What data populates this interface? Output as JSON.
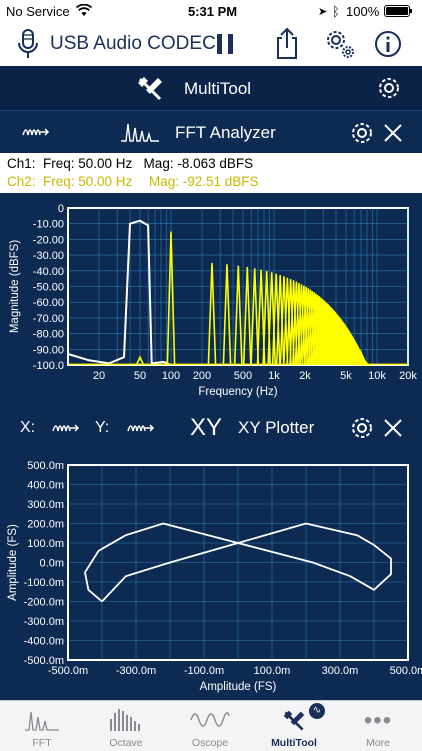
{
  "status": {
    "carrier": "No Service",
    "time": "5:31 PM",
    "battery": "100%"
  },
  "toolbar": {
    "device": "USB Audio CODEC"
  },
  "multitool": {
    "title": "MultiTool"
  },
  "fft": {
    "title": "FFT Analyzer",
    "ch1": "Ch1:  Freq: 50.00 Hz   Mag: -8.063 dBFS",
    "ch2_freq": "Ch2:  Freq: 50.00 Hz",
    "ch2_mag": "Mag: -92.51 dBFS",
    "colors": {
      "ch1": "#ffffff",
      "ch2": "#ffff00",
      "grid": "#3aa0d8"
    }
  },
  "xy": {
    "x_label": "X:",
    "y_label": "Y:",
    "big": "XY",
    "title": "XY Plotter"
  },
  "chart_data": [
    {
      "type": "line",
      "title": "",
      "xlabel": "Frequency (Hz)",
      "ylabel": "Magnitude (dBFS)",
      "xscale": "log",
      "xlim": [
        10,
        20000
      ],
      "ylim": [
        -100,
        0
      ],
      "x_ticks": [
        "20",
        "50",
        "100",
        "200",
        "500",
        "1k",
        "2k",
        "5k",
        "10k",
        "20k"
      ],
      "y_ticks": [
        "0",
        "-10.00",
        "-20.00",
        "-30.00",
        "-40.00",
        "-50.00",
        "-60.00",
        "-70.00",
        "-80.00",
        "-90.00",
        "-100.0"
      ],
      "series": [
        {
          "points": [
            [
              10,
              -93
            ],
            [
              16,
              -97
            ],
            [
              25,
              -99
            ],
            [
              35,
              -95
            ],
            [
              40,
              -10
            ],
            [
              50,
              -8.063
            ],
            [
              60,
              -11
            ],
            [
              65,
              -99
            ],
            [
              85,
              -98
            ],
            [
              100,
              -100
            ],
            [
              200,
              -100
            ],
            [
              1000,
              -100
            ],
            [
              20000,
              -100
            ]
          ]
        },
        {
          "harmonic_peaks_hz": [
            50,
            100,
            250,
            350,
            450,
            550,
            650,
            750,
            850,
            950,
            1050,
            1150,
            1250,
            1350,
            1450,
            1550,
            1650,
            1750,
            1850,
            1950,
            2050,
            2150,
            2250,
            2350,
            2450,
            2550,
            2650,
            2750,
            2850,
            2950,
            3050,
            3150,
            3250,
            3350,
            3450,
            3550,
            3650,
            3750,
            3850,
            3950,
            4050,
            4150,
            4250,
            4350,
            4450,
            4550,
            4650,
            4750,
            4850,
            4950,
            5050,
            5150,
            5250,
            5350,
            5450,
            5550,
            5650,
            5750,
            5850,
            5950,
            6050,
            6150,
            6250,
            6350,
            6450,
            6550,
            6650,
            6750,
            6850,
            6950,
            7050,
            7150,
            7250,
            7350,
            7450,
            7550,
            7650,
            7750,
            7850,
            7950,
            8050
          ],
          "fundamental_dbfs": -15,
          "base_level_dbfs": -100,
          "ch2_50hz_dbfs": -92.51
        }
      ],
      "grid": true
    },
    {
      "type": "line",
      "title": "",
      "xlabel": "Amplitude (FS)",
      "ylabel": "Amplitude (FS)",
      "xlim": [
        -0.5,
        0.5
      ],
      "ylim": [
        -0.5,
        0.5
      ],
      "x_ticks": [
        "-500.0m",
        "-300.0m",
        "-100.0m",
        "100.0m",
        "300.0m",
        "500.0m"
      ],
      "y_ticks": [
        "500.0m",
        "400.0m",
        "300.0m",
        "200.0m",
        "100.0m",
        "0.0m",
        "-100.0m",
        "-200.0m",
        "-300.0m",
        "-400.0m",
        "-500.0m"
      ],
      "series": [
        {
          "points": [
            [
              -0.4,
              -0.2
            ],
            [
              -0.44,
              -0.14
            ],
            [
              -0.45,
              -0.05
            ],
            [
              -0.41,
              0.06
            ],
            [
              -0.33,
              0.14
            ],
            [
              -0.22,
              0.2
            ],
            [
              0.0,
              0.1
            ],
            [
              0.22,
              -0.0
            ],
            [
              0.33,
              -0.07
            ],
            [
              0.4,
              -0.14
            ],
            [
              0.45,
              -0.06
            ],
            [
              0.45,
              0.02
            ],
            [
              0.4,
              0.09
            ],
            [
              0.35,
              0.14
            ],
            [
              0.2,
              0.2
            ],
            [
              0.0,
              0.1
            ],
            [
              -0.2,
              0.0
            ],
            [
              -0.33,
              -0.07
            ],
            [
              -0.4,
              -0.2
            ]
          ]
        }
      ],
      "grid": true
    }
  ],
  "tabs": [
    {
      "label": "FFT"
    },
    {
      "label": "Octave"
    },
    {
      "label": "Oscope"
    },
    {
      "label": "MultiTool"
    },
    {
      "label": "More"
    }
  ]
}
